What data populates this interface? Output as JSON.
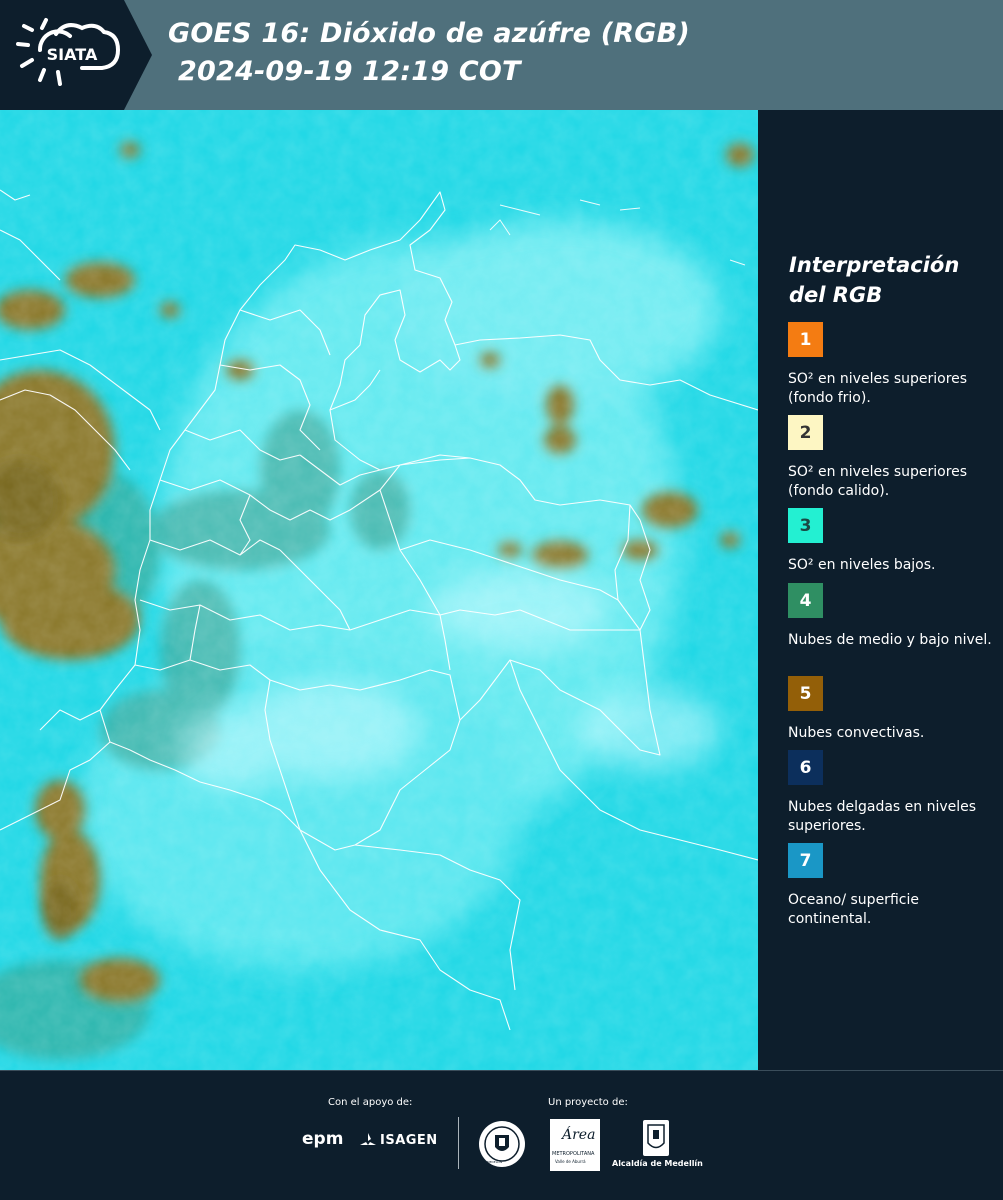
{
  "header": {
    "logo_text": "SIATA",
    "title_line1": "GOES 16: Dióxido de azúfre (RGB)",
    "title_line2": "2024-09-19 12:19 COT"
  },
  "map": {
    "icon": "satellite-rgb-map",
    "ocean_color": "#22d8e6",
    "cloud_color": "#8c7a2e",
    "border_color": "#ffffff"
  },
  "legend": {
    "title": "Interpretación del RGB",
    "items": [
      {
        "number": "1",
        "color": "#f47c12",
        "number_color": "#ffffff",
        "label": "SO² en niveles superiores (fondo frio)."
      },
      {
        "number": "2",
        "color": "#fdf6c3",
        "number_color": "#333333",
        "label": "SO² en niveles superiores (fondo calido)."
      },
      {
        "number": "3",
        "color": "#23f0d2",
        "number_color": "#1a4a44",
        "label": "SO² en niveles bajos."
      },
      {
        "number": "4",
        "color": "#2f8f63",
        "number_color": "#ffffff",
        "label": "Nubes de medio y bajo nivel."
      },
      {
        "number": "5",
        "color": "#935f08",
        "number_color": "#ffffff",
        "label": "Nubes convectivas."
      },
      {
        "number": "6",
        "color": "#0c2f5c",
        "number_color": "#ffffff",
        "label": "Nubes delgadas en niveles superiores."
      },
      {
        "number": "7",
        "color": "#1a97c6",
        "number_color": "#ffffff",
        "label": "Oceano/ superficie continental."
      }
    ]
  },
  "footer": {
    "support_label": "Con el apoyo de:",
    "project_label": "Un proyecto de:",
    "logos": {
      "epm": "epm",
      "isagen": "ISAGEN",
      "medellin_seal": "MEDELLIN",
      "area_metro": "Área",
      "area_metro_sub": "METROPOLITANA",
      "area_metro_sub2": "Valle de Aburrá",
      "alcaldia": "Alcaldía de Medellín"
    }
  }
}
